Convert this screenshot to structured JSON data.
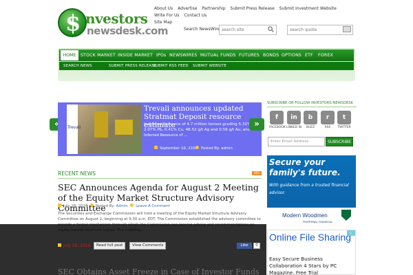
{
  "logo": {
    "dollar": "$",
    "word1": "nvestors",
    "word2": "newsdesk.com"
  },
  "top_links": [
    "About Us",
    "Advertise",
    "Partnership",
    "Submit Press Release",
    "Submit Investment Website",
    "Write For Us",
    "Contact Us",
    "Site Map"
  ],
  "search": {
    "label": "Search NewsWires",
    "placeholder": "search site",
    "quote_placeholder": "search quote"
  },
  "nav_primary": [
    "HOME",
    "STOCK MARKET",
    "INSIDE MARKET",
    "IPOs",
    "NEWSWIRES",
    "MUTUAL FUNDS",
    "FUTURES",
    "BONDS",
    "OPTIONS",
    "ETF",
    "FOREX"
  ],
  "nav_secondary": [
    "SEARCH NEWS",
    "SUBMIT PRESS RELEASE",
    "SUBMIT RSS FEED",
    "SUBMIT WEBSITE"
  ],
  "slider": {
    "title": "Trevali announces updated Stratmat Deposit resource estimate",
    "text": "Indicated Resource of 4.7 million tonnes grading 5.31% zinc, 2.07% Pb, 0.41% Cu, 48.52 g/t Ag and 0.59 g/t Au, and Inferred Resource of ...",
    "date": "September 10, 2105",
    "author": "Posted By: admin",
    "image_brand": "Trevali",
    "prev_arrow": "«",
    "next_arrow": "»"
  },
  "recent": {
    "heading": "RECENT NEWS",
    "rss": "RSS"
  },
  "article": {
    "title": "SEC Announces Agenda for August 2 Meeting of the Equity Market Structure Advisory Committee",
    "meta_date": "July 28, 2016",
    "meta_posted": "Posted By:",
    "meta_author": "Admin",
    "meta_comment": "Leave A Comment",
    "body": "The Securities and Exchange Commission will hold a meeting of the Equity Market Structure Advisory Committee on August 2, beginning at 9:30 a.m. EDT.  The Commission established the advisory committee to provide a formal mechanism through which the Commission can receive advice and recommendations on equity market structure issues. The meeting...",
    "date": "July 28, 2016",
    "read_full": "Read full post",
    "comments": "View Comments",
    "like": "Like",
    "like_count": "0"
  },
  "next_article_title": "SEC Obtains Asset Freeze in Case of Investor Funds",
  "sidebar": {
    "heading": "SUBSCRIBE OR FOLLOW INVESTORS-NEWSDESK",
    "social": [
      {
        "label": "FACEBOOK",
        "glyph": "f"
      },
      {
        "label": "LINKED IN",
        "glyph": "in"
      },
      {
        "label": "BUZZ",
        "glyph": "b"
      },
      {
        "label": "RSS",
        "glyph": "r"
      },
      {
        "label": "TWITTER",
        "glyph": "t"
      }
    ],
    "email_placeholder": "Enter Email Address",
    "subscribe": "SUBSCRIBE"
  },
  "ad1": {
    "headline": "Secure your family's future.",
    "sub": "With guidance from a trusted financial advisor.",
    "brand": "Modern Woodmen",
    "brand_sub": "FRATERNAL FINANCIAL"
  },
  "ad2": {
    "headline": "Online File Sharing",
    "text": "Easy Secure Business Collaboration 4 Stars by PC Magazine. Free Trial",
    "badge": "▷"
  },
  "colors": {
    "nav_green": "#137213",
    "slider_bg": "#6e6ef0",
    "accent_green": "#2a8a2a"
  }
}
